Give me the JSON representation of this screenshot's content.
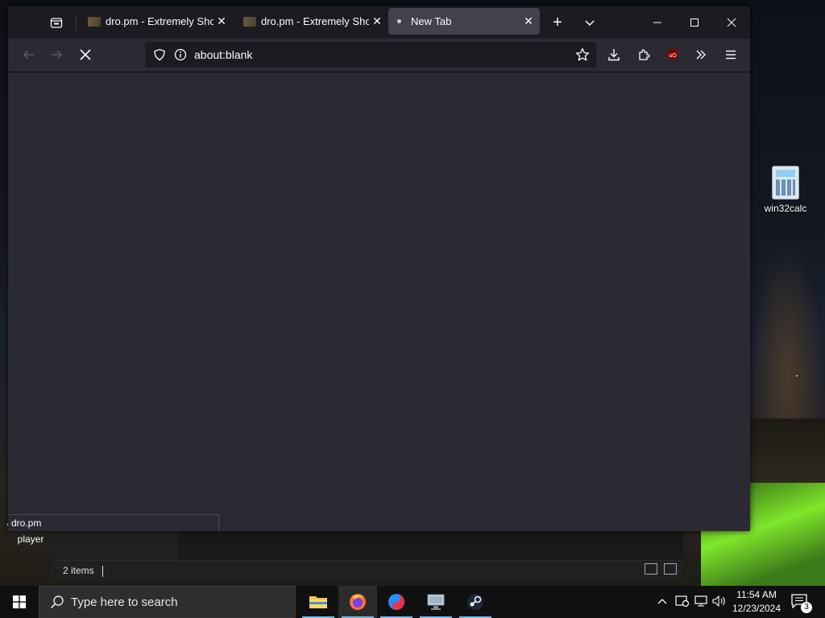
{
  "browser": {
    "tabs": [
      {
        "title": "dro.pm - Extremely Short URL",
        "active": false
      },
      {
        "title": "dro.pm - Extremely Short URL",
        "active": false
      },
      {
        "title": "New Tab",
        "active": true
      }
    ],
    "url": "about:blank",
    "status_text": "dro.pm"
  },
  "desktop": {
    "icons": [
      {
        "label": "win32calc",
        "icon": "calculator-icon"
      },
      {
        "label": "VLC media player",
        "icon": "vlc-icon"
      }
    ]
  },
  "explorer": {
    "status": "2 items"
  },
  "taskbar": {
    "search_placeholder": "Type here to search",
    "apps": [
      "file-explorer-icon",
      "firefox-icon",
      "app-icon",
      "remote-desktop-icon",
      "steam-icon"
    ],
    "time": "11:54 AM",
    "date": "12/23/2024",
    "notification_count": "3"
  },
  "colors": {
    "browser_bg": "#2b2a33",
    "tabbar_bg": "#1c1b22",
    "active_tab": "#42414d",
    "taskbar_bg": "#101010",
    "accent": "#76b9ed"
  }
}
